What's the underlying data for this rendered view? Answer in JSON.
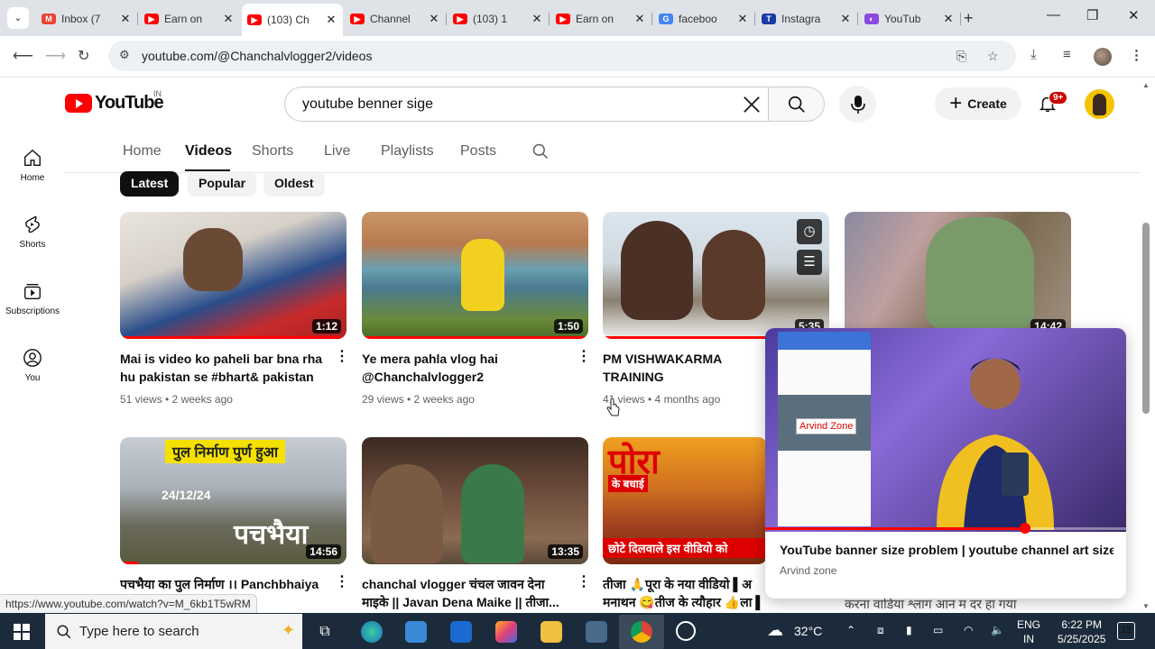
{
  "browser": {
    "tabs": [
      {
        "title": "Inbox (7",
        "fav": "gmail"
      },
      {
        "title": "Earn on",
        "fav": "youtube"
      },
      {
        "title": "(103) Ch",
        "fav": "youtube"
      },
      {
        "title": "Channel",
        "fav": "youtube"
      },
      {
        "title": "(103) 1",
        "fav": "youtube"
      },
      {
        "title": "Earn on",
        "fav": "youtube"
      },
      {
        "title": "faceboo",
        "fav": "google"
      },
      {
        "title": "Instagra",
        "fav": "t"
      },
      {
        "title": "YouTub",
        "fav": "ext"
      }
    ],
    "url": "youtube.com/@Chanchalvlogger2/videos"
  },
  "yt": {
    "logo_text": "YouTube",
    "country_code": "IN",
    "search_value": "youtube benner sige",
    "create_label": "Create",
    "notif_badge": "9+"
  },
  "sidebar": {
    "items": [
      {
        "label": "Home"
      },
      {
        "label": "Shorts"
      },
      {
        "label": "Subscriptions"
      },
      {
        "label": "You"
      }
    ]
  },
  "channel_tabs": [
    "Home",
    "Videos",
    "Shorts",
    "Live",
    "Playlists",
    "Posts"
  ],
  "chips": [
    "Latest",
    "Popular",
    "Oldest"
  ],
  "videos": [
    {
      "title": "Mai is video ko paheli bar bna rha hu pakistan se #bhart& pakistan",
      "meta": "51 views • 2 weeks ago",
      "duration": "1:12",
      "progress": 1.0
    },
    {
      "title": "Ye mera pahla vlog hai @Chanchalvlogger2",
      "meta": "29 views • 2 weeks ago",
      "duration": "1:50",
      "progress": 1.0
    },
    {
      "title": "PM VISHWAKARMA TRAINING CHHATTISGARH ENGINEERI",
      "meta": "41 views • 4 months ago",
      "duration": "5:35",
      "progress": 1.0
    },
    {
      "title": "",
      "meta": "",
      "duration": "14:42",
      "progress": 0
    },
    {
      "title": "पचभैया का पुल निर्माण ।। Panchbhaiya",
      "meta": "",
      "duration": "14:56",
      "progress": 0.08,
      "overlay_top": "पुल निर्माण पुर्ण हुआ",
      "overlay_date": "24/12/24",
      "overlay_big": "पचभैया"
    },
    {
      "title": "chanchal vlogger चंचल जावन देना माइके || Javan Dena Maike || तीजा...",
      "meta": "",
      "duration": "13:35",
      "progress": 0
    },
    {
      "title": "तीजा 🙏पूरा के नया वीडियो ▌अ मनाथन 😋तीज के त्यौहार 👍ला ▌😊...",
      "meta": "",
      "duration": "",
      "progress": 0,
      "overlay_top": "पोरा",
      "overlay_sub": "के बधाई",
      "overlay_bottom": "छोटे दिलवाले इस वीडियो को"
    },
    {
      "title": "करना वाडिया श्लाग आन म दर हा गया",
      "meta": "",
      "duration": "",
      "progress": 0
    }
  ],
  "popup": {
    "title": "YouTube banner size problem | youtube channel art size ...",
    "channel": "Arvind zone",
    "inner_label": "Arvind Zone",
    "progress": 0.72
  },
  "status_url": "https://www.youtube.com/watch?v=M_6kb1T5wRM",
  "taskbar": {
    "search_placeholder": "Type here to search",
    "temp": "32°C",
    "lang1": "ENG",
    "lang2": "IN",
    "time": "6:22 PM",
    "date": "5/25/2025",
    "notif_count": "12"
  }
}
